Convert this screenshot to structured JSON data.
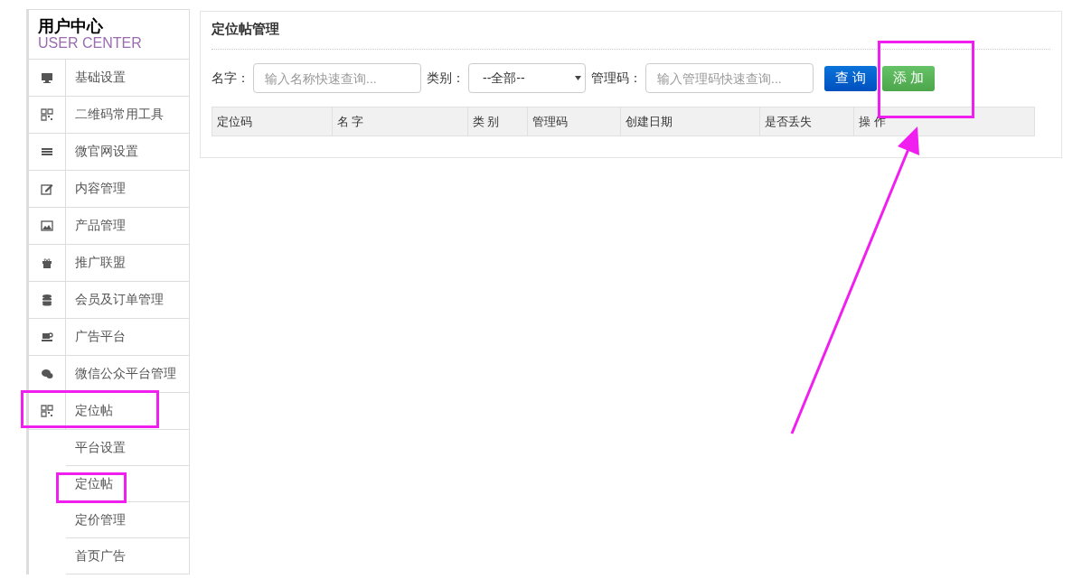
{
  "sidebar": {
    "title": "用户中心",
    "subtitle": "USER CENTER",
    "items": [
      {
        "label": "基础设置"
      },
      {
        "label": "二维码常用工具"
      },
      {
        "label": "微官网设置"
      },
      {
        "label": "内容管理"
      },
      {
        "label": "产品管理"
      },
      {
        "label": "推广联盟"
      },
      {
        "label": "会员及订单管理"
      },
      {
        "label": "广告平台"
      },
      {
        "label": "微信公众平台管理"
      },
      {
        "label": "定位帖",
        "children": [
          {
            "label": "平台设置"
          },
          {
            "label": "定位帖"
          },
          {
            "label": "定价管理"
          },
          {
            "label": "首页广告"
          }
        ]
      }
    ]
  },
  "panel": {
    "title": "定位帖管理",
    "filters": [
      {
        "kind": "input",
        "label": "名字：",
        "placeholder": "输入名称快速查询..."
      },
      {
        "kind": "select",
        "label": "类别：",
        "value": "--全部--"
      },
      {
        "kind": "input",
        "label": "管理码：",
        "placeholder": "输入管理码快速查询..."
      }
    ],
    "buttons": [
      {
        "kind": "primary",
        "label": "查 询"
      },
      {
        "kind": "success",
        "label": "添 加"
      }
    ],
    "table": {
      "columns": [
        "定位码",
        "名 字",
        "类 别",
        "管理码",
        "创建日期",
        "是否丢失",
        "操 作"
      ]
    }
  }
}
